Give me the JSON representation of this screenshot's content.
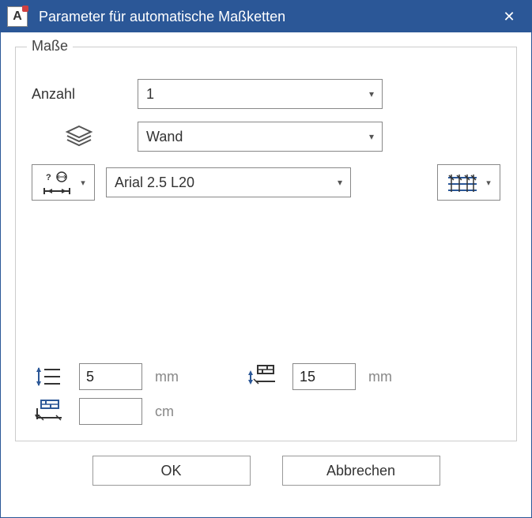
{
  "window": {
    "title": "Parameter für automatische Maßketten"
  },
  "group": {
    "title": "Maße",
    "count_label": "Anzahl",
    "count_value": "1",
    "layer_value": "Wand",
    "font_value": "Arial 2.5 L20"
  },
  "params": {
    "spacing_value": "5",
    "spacing_unit": "mm",
    "offset_value": "15",
    "offset_unit": "mm",
    "third_value": "",
    "third_unit": "cm"
  },
  "buttons": {
    "ok": "OK",
    "cancel": "Abbrechen"
  }
}
